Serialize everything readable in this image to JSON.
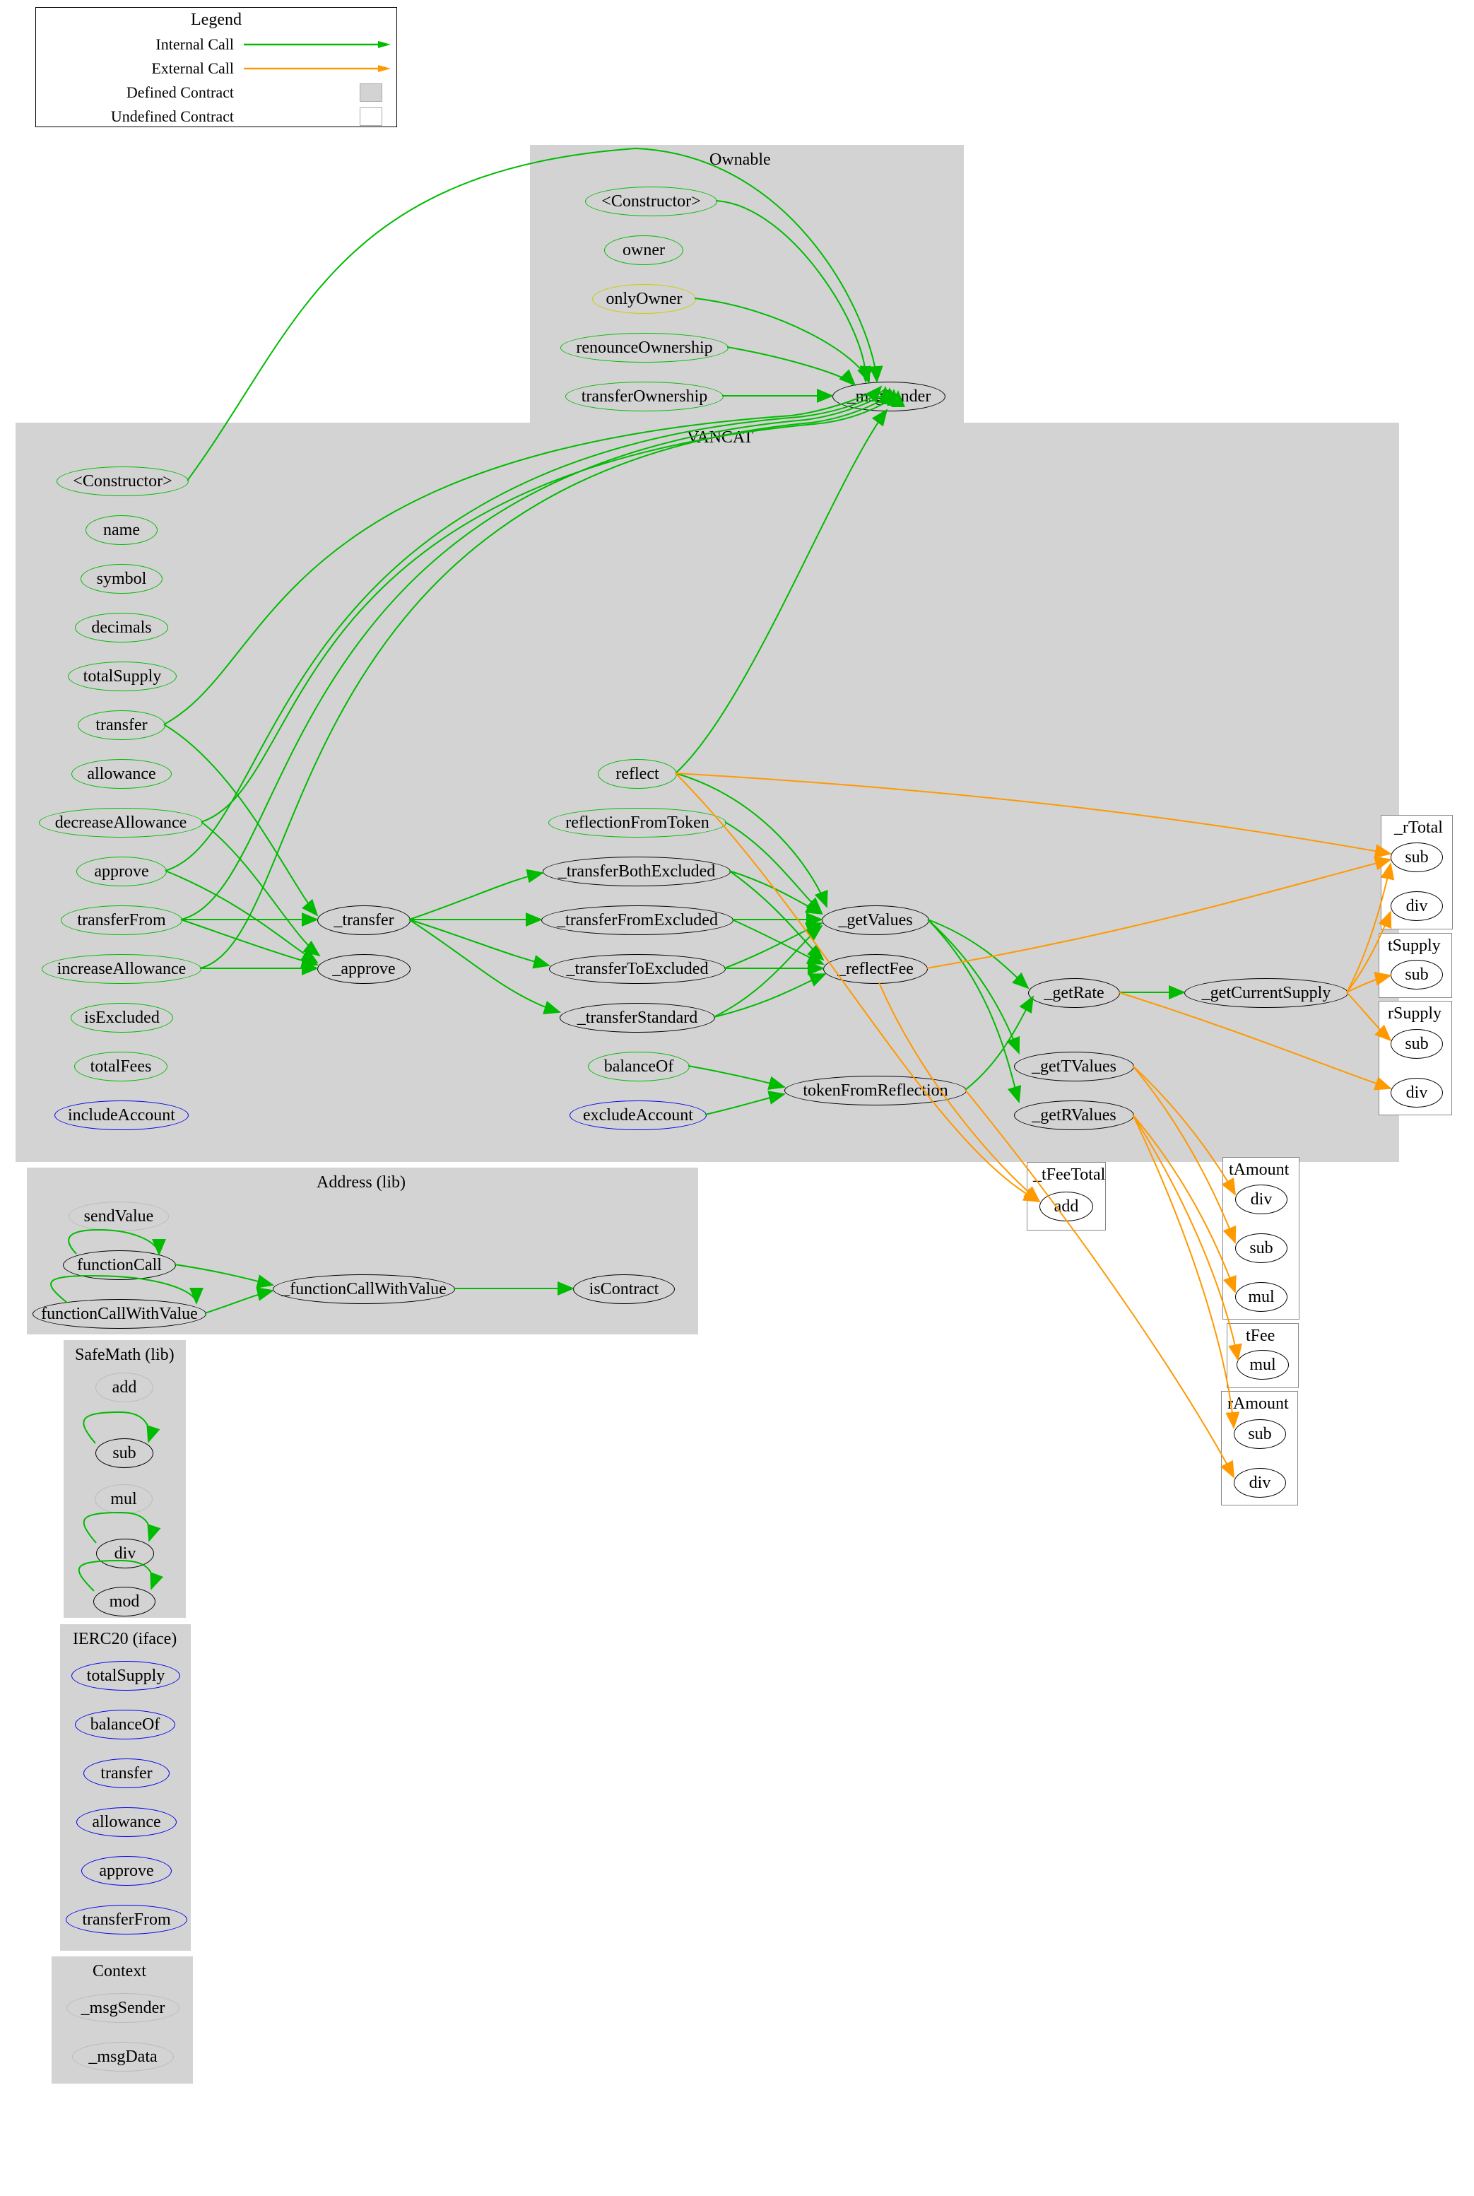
{
  "legend": {
    "title": "Legend",
    "rows": [
      {
        "label": "Internal Call",
        "kind": "arrow",
        "color": "#0b0"
      },
      {
        "label": "External Call",
        "kind": "arrow",
        "color": "#f90"
      },
      {
        "label": "Defined Contract",
        "kind": "square",
        "color": "#d3d3d3"
      },
      {
        "label": "Undefined Contract",
        "kind": "square",
        "color": "#fff"
      }
    ]
  },
  "clusters": {
    "ownable": {
      "title": "Ownable"
    },
    "vancat": {
      "title": "VANCAT"
    },
    "address": {
      "title": "Address  (lib)"
    },
    "safemath": {
      "title": "SafeMath  (lib)"
    },
    "ierc20": {
      "title": "IERC20  (iface)"
    },
    "context": {
      "title": "Context"
    },
    "rTotal": {
      "title": "_rTotal"
    },
    "tSupply": {
      "title": "tSupply"
    },
    "rSupply": {
      "title": "rSupply"
    },
    "tAmount": {
      "title": "tAmount"
    },
    "tFee": {
      "title": "tFee"
    },
    "rAmount": {
      "title": "rAmount"
    },
    "tFeeTotal": {
      "title": "_tFeeTotal"
    }
  },
  "nodes": {
    "own_ctor": "<Constructor>",
    "own_owner": "owner",
    "own_onlyOwner": "onlyOwner",
    "own_renounce": "renounceOwnership",
    "own_transfer": "transferOwnership",
    "msgSender": "_msgSender",
    "v_ctor": "<Constructor>",
    "v_name": "name",
    "v_symbol": "symbol",
    "v_decimals": "decimals",
    "v_totalSupply": "totalSupply",
    "v_transfer": "transfer",
    "v_allowance": "allowance",
    "v_decAllow": "decreaseAllowance",
    "v_approve": "approve",
    "v_transferFrom": "transferFrom",
    "v_incAllow": "increaseAllowance",
    "v_isExcluded": "isExcluded",
    "v_totalFees": "totalFees",
    "v_includeAccount": "includeAccount",
    "v_reflect": "reflect",
    "v_reflFromToken": "reflectionFromToken",
    "v_xferBoth": "_transferBothExcluded",
    "v_xferFromEx": "_transferFromExcluded",
    "v_xferToEx": "_transferToExcluded",
    "v_xferStd": "_transferStandard",
    "v_balanceOf": "balanceOf",
    "v_excludeAccount": "excludeAccount",
    "v__transfer": "_transfer",
    "v__approve": "_approve",
    "v_getValues": "_getValues",
    "v_reflectFee": "_reflectFee",
    "v_tokenFromRefl": "tokenFromReflection",
    "v_getRate": "_getRate",
    "v_getTValues": "_getTValues",
    "v_getRValues": "_getRValues",
    "v_getCurSupply": "_getCurrentSupply",
    "a_sendValue": "sendValue",
    "a_functionCall": "functionCall",
    "a_functionCallWV": "functionCallWithValue",
    "a__functionCallWV": "_functionCallWithValue",
    "a_isContract": "isContract",
    "sm_add": "add",
    "sm_sub": "sub",
    "sm_mul": "mul",
    "sm_div": "div",
    "sm_mod": "mod",
    "i_totalSupply": "totalSupply",
    "i_balanceOf": "balanceOf",
    "i_transfer": "transfer",
    "i_allowance": "allowance",
    "i_approve": "approve",
    "i_transferFrom": "transferFrom",
    "c_msgSender": "_msgSender",
    "c_msgData": "_msgData",
    "rT_sub": "sub",
    "rT_div": "div",
    "tS_sub": "sub",
    "rS_sub": "sub",
    "rS_div": "div",
    "tA_div": "div",
    "tA_sub": "sub",
    "tA_mul": "mul",
    "tF_mul": "mul",
    "rA_sub": "sub",
    "rA_div": "div",
    "tFT_add": "add"
  },
  "chart_data": {
    "type": "graph",
    "note": "Solidity call graph. Edges: green = internal call, orange = external call. Grey clusters = defined contracts/libs; white clusters = undefined.",
    "clusters": [
      {
        "id": "Ownable",
        "kind": "defined",
        "nodes": [
          "<Constructor>",
          "owner",
          "onlyOwner",
          "renounceOwnership",
          "transferOwnership",
          "_msgSender"
        ]
      },
      {
        "id": "VANCAT",
        "kind": "defined",
        "nodes": [
          "<Constructor>",
          "name",
          "symbol",
          "decimals",
          "totalSupply",
          "transfer",
          "allowance",
          "decreaseAllowance",
          "approve",
          "transferFrom",
          "increaseAllowance",
          "isExcluded",
          "totalFees",
          "includeAccount",
          "reflect",
          "reflectionFromToken",
          "_transferBothExcluded",
          "_transferFromExcluded",
          "_transferToExcluded",
          "_transferStandard",
          "balanceOf",
          "excludeAccount",
          "_transfer",
          "_approve",
          "_getValues",
          "_reflectFee",
          "tokenFromReflection",
          "_getRate",
          "_getTValues",
          "_getRValues",
          "_getCurrentSupply"
        ]
      },
      {
        "id": "Address (lib)",
        "kind": "defined",
        "nodes": [
          "sendValue",
          "functionCall",
          "functionCallWithValue",
          "_functionCallWithValue",
          "isContract"
        ]
      },
      {
        "id": "SafeMath (lib)",
        "kind": "defined",
        "nodes": [
          "add",
          "sub",
          "mul",
          "div",
          "mod"
        ]
      },
      {
        "id": "IERC20 (iface)",
        "kind": "defined",
        "nodes": [
          "totalSupply",
          "balanceOf",
          "transfer",
          "allowance",
          "approve",
          "transferFrom"
        ]
      },
      {
        "id": "Context",
        "kind": "defined",
        "nodes": [
          "_msgSender",
          "_msgData"
        ]
      },
      {
        "id": "_rTotal",
        "kind": "undefined",
        "nodes": [
          "sub",
          "div"
        ]
      },
      {
        "id": "tSupply",
        "kind": "undefined",
        "nodes": [
          "sub"
        ]
      },
      {
        "id": "rSupply",
        "kind": "undefined",
        "nodes": [
          "sub",
          "div"
        ]
      },
      {
        "id": "tAmount",
        "kind": "undefined",
        "nodes": [
          "div",
          "sub",
          "mul"
        ]
      },
      {
        "id": "tFee",
        "kind": "undefined",
        "nodes": [
          "mul"
        ]
      },
      {
        "id": "rAmount",
        "kind": "undefined",
        "nodes": [
          "sub",
          "div"
        ]
      },
      {
        "id Nugget": "_tFeeTotal",
        "kind": "undefined",
        "nodes": [
          "add"
        ]
      }
    ],
    "edges_internal": [
      [
        "Ownable.<Constructor>",
        "Ownable._msgSender"
      ],
      [
        "Ownable.onlyOwner",
        "Ownable._msgSender"
      ],
      [
        "Ownable.renounceOwnership",
        "Ownable._msgSender"
      ],
      [
        "Ownable.transferOwnership",
        "Ownable._msgSender"
      ],
      [
        "VANCAT.<Constructor>",
        "Ownable._msgSender"
      ],
      [
        "VANCAT.transfer",
        "Ownable._msgSender"
      ],
      [
        "VANCAT.transfer",
        "VANCAT._transfer"
      ],
      [
        "VANCAT.approve",
        "Ownable._msgSender"
      ],
      [
        "VANCAT.approve",
        "VANCAT._approve"
      ],
      [
        "VANCAT.transferFrom",
        "Ownable._msgSender"
      ],
      [
        "VANCAT.transferFrom",
        "VANCAT._transfer"
      ],
      [
        "VANCAT.transferFrom",
        "VANCAT._approve"
      ],
      [
        "VANCAT.increaseAllowance",
        "Ownable._msgSender"
      ],
      [
        "VANCAT.increaseAllowance",
        "VANCAT._approve"
      ],
      [
        "VANCAT.decreaseAllowance",
        "Ownable._msgSender"
      ],
      [
        "VANCAT.decreaseAllowance",
        "VANCAT._approve"
      ],
      [
        "VANCAT.reflect",
        "Ownable._msgSender"
      ],
      [
        "VANCAT.reflect",
        "VANCAT._getValues"
      ],
      [
        "VANCAT.reflectionFromToken",
        "VANCAT._getValues"
      ],
      [
        "VANCAT._transfer",
        "VANCAT._transferBothExcluded"
      ],
      [
        "VANCAT._transfer",
        "VANCAT._transferFromExcluded"
      ],
      [
        "VANCAT._transfer",
        "VANCAT._transferToExcluded"
      ],
      [
        "VANCAT._transfer",
        "VANCAT._transferStandard"
      ],
      [
        "VANCAT._transferBothExcluded",
        "VANCAT._getValues"
      ],
      [
        "VANCAT._transferBothExcluded",
        "VANCAT._reflectFee"
      ],
      [
        "VANCAT._transferFromExcluded",
        "VANCAT._getValues"
      ],
      [
        "VANCAT._transferFromExcluded",
        "VANCAT._reflectFee"
      ],
      [
        "VANCAT._transferToExcluded",
        "VANCAT._getValues"
      ],
      [
        "VANCAT._transferToExcluded",
        "VANCAT._reflectFee"
      ],
      [
        "VANCAT._transferStandard",
        "VANCAT._getValues"
      ],
      [
        "VANCAT._transferStandard",
        "VANCAT._reflectFee"
      ],
      [
        "VANCAT._getValues",
        "VANCAT._getRate"
      ],
      [
        "VANCAT._getValues",
        "VANCAT._getTValues"
      ],
      [
        "VANCAT._getValues",
        "VANCAT._getRValues"
      ],
      [
        "VANCAT.balanceOf",
        "VANCAT.tokenFromReflection"
      ],
      [
        "VANCAT.excludeAccount",
        "VANCAT.tokenFromReflection"
      ],
      [
        "VANCAT.tokenFromReflection",
        "VANCAT._getRate"
      ],
      [
        "VANCAT._getRate",
        "VANCAT._getCurrentSupply"
      ],
      [
        "Address.functionCall",
        "Address._functionCallWithValue"
      ],
      [
        "Address.functionCall",
        "Address.functionCall"
      ],
      [
        "Address.functionCallWithValue",
        "Address._functionCallWithValue"
      ],
      [
        "Address.functionCallWithValue",
        "Address.functionCallWithValue"
      ],
      [
        "Address._functionCallWithValue",
        "Address.isContract"
      ],
      [
        "SafeMath.sub",
        "SafeMath.sub"
      ],
      [
        "SafeMath.div",
        "SafeMath.div"
      ],
      [
        "SafeMath.mod",
        "SafeMath.mod"
      ]
    ],
    "edges_external": [
      [
        "VANCAT.reflect",
        "_rTotal.sub"
      ],
      [
        "VANCAT.reflect",
        "_tFeeTotal.add"
      ],
      [
        "VANCAT._reflectFee",
        "_rTotal.sub"
      ],
      [
        "VANCAT._reflectFee",
        "_tFeeTotal.add"
      ],
      [
        "VANCAT._getCurrentSupply",
        "_rTotal.sub"
      ],
      [
        "VANCAT._getCurrentSupply",
        "_rTotal.div"
      ],
      [
        "VANCAT._getCurrentSupply",
        "tSupply.sub"
      ],
      [
        "VANCAT._getCurrentSupply",
        "rSupply.sub"
      ],
      [
        "VANCAT._getRate",
        "rSupply.div"
      ],
      [
        "VANCAT._getTValues",
        "tAmount.div"
      ],
      [
        "VANCAT._getTValues",
        "tAmount.sub"
      ],
      [
        "VANCAT._getRValues",
        "tAmount.mul"
      ],
      [
        "VANCAT._getRValues",
        "tFee.mul"
      ],
      [
        "VANCAT._getRValues",
        "rAmount.sub"
      ],
      [
        "VANCAT.tokenFromReflection",
        "rAmount.div"
      ]
    ]
  }
}
